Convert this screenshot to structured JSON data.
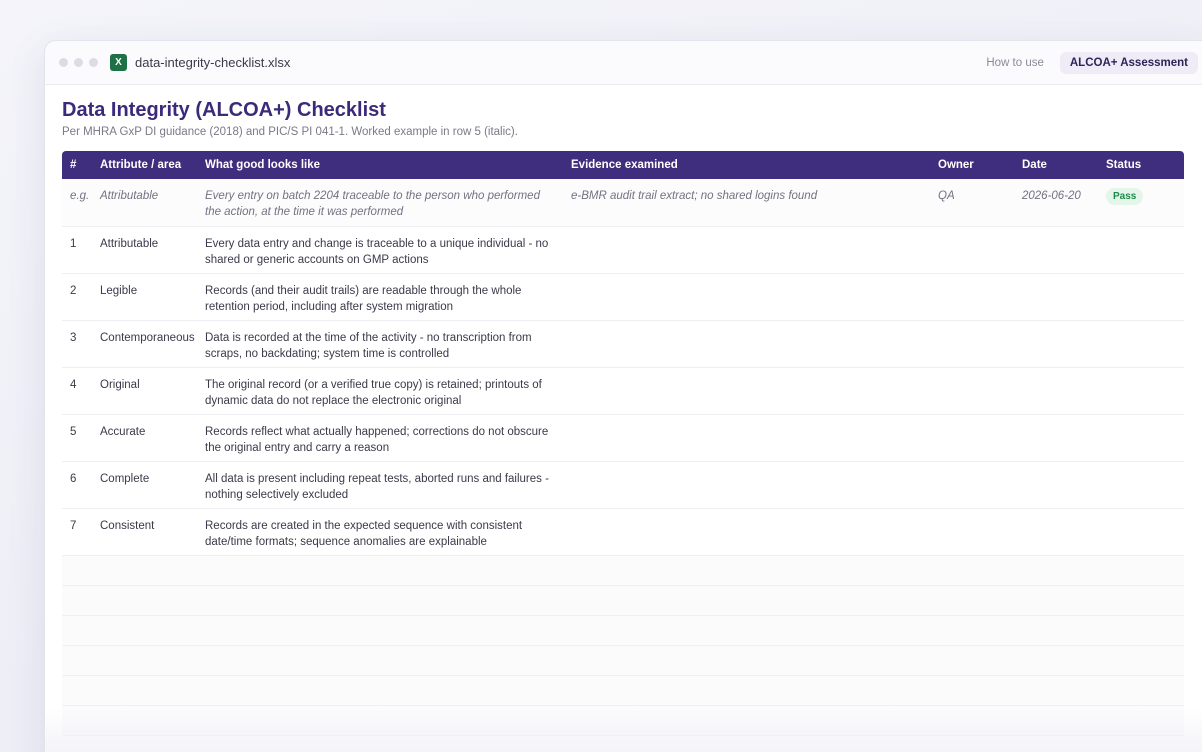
{
  "window": {
    "filename": "data-integrity-checklist.xlsx",
    "file_icon_letter": "X",
    "tabs": [
      {
        "label": "How to use",
        "active": false
      },
      {
        "label": "ALCOA+ Assessment",
        "active": true
      }
    ]
  },
  "sheet": {
    "title": "Data Integrity (ALCOA+) Checklist",
    "subtitle": "Per MHRA GxP DI guidance (2018) and PIC/S PI 041-1. Worked example in row 5 (italic).",
    "columns": [
      "#",
      "Attribute / area",
      "What good looks like",
      "Evidence examined",
      "Owner",
      "Date",
      "Status"
    ],
    "example_row": {
      "num": "e.g.",
      "attribute": "Attributable",
      "good": "Every entry on batch 2204 traceable to the person who performed the action, at the time it was performed",
      "evidence": "e-BMR audit trail extract; no shared logins found",
      "owner": "QA",
      "date": "2026-06-20",
      "status": "Pass"
    },
    "rows": [
      {
        "num": "1",
        "attribute": "Attributable",
        "good": "Every data entry and change is traceable to a unique individual - no shared or generic accounts on GMP actions",
        "evidence": "",
        "owner": "",
        "date": "",
        "status": ""
      },
      {
        "num": "2",
        "attribute": "Legible",
        "good": "Records (and their audit trails) are readable through the whole retention period, including after system migration",
        "evidence": "",
        "owner": "",
        "date": "",
        "status": ""
      },
      {
        "num": "3",
        "attribute": "Contemporaneous",
        "good": "Data is recorded at the time of the activity - no transcription from scraps, no backdating; system time is controlled",
        "evidence": "",
        "owner": "",
        "date": "",
        "status": ""
      },
      {
        "num": "4",
        "attribute": "Original",
        "good": "The original record (or a verified true copy) is retained; printouts of dynamic data do not replace the electronic original",
        "evidence": "",
        "owner": "",
        "date": "",
        "status": ""
      },
      {
        "num": "5",
        "attribute": "Accurate",
        "good": "Records reflect what actually happened; corrections do not obscure the original entry and carry a reason",
        "evidence": "",
        "owner": "",
        "date": "",
        "status": ""
      },
      {
        "num": "6",
        "attribute": "Complete",
        "good": "All data is present including repeat tests, aborted runs and failures - nothing selectively excluded",
        "evidence": "",
        "owner": "",
        "date": "",
        "status": ""
      },
      {
        "num": "7",
        "attribute": "Consistent",
        "good": "Records are created in the expected sequence with consistent date/time formats; sequence anomalies are explainable",
        "evidence": "",
        "owner": "",
        "date": "",
        "status": ""
      }
    ],
    "empty_rows": 6
  }
}
